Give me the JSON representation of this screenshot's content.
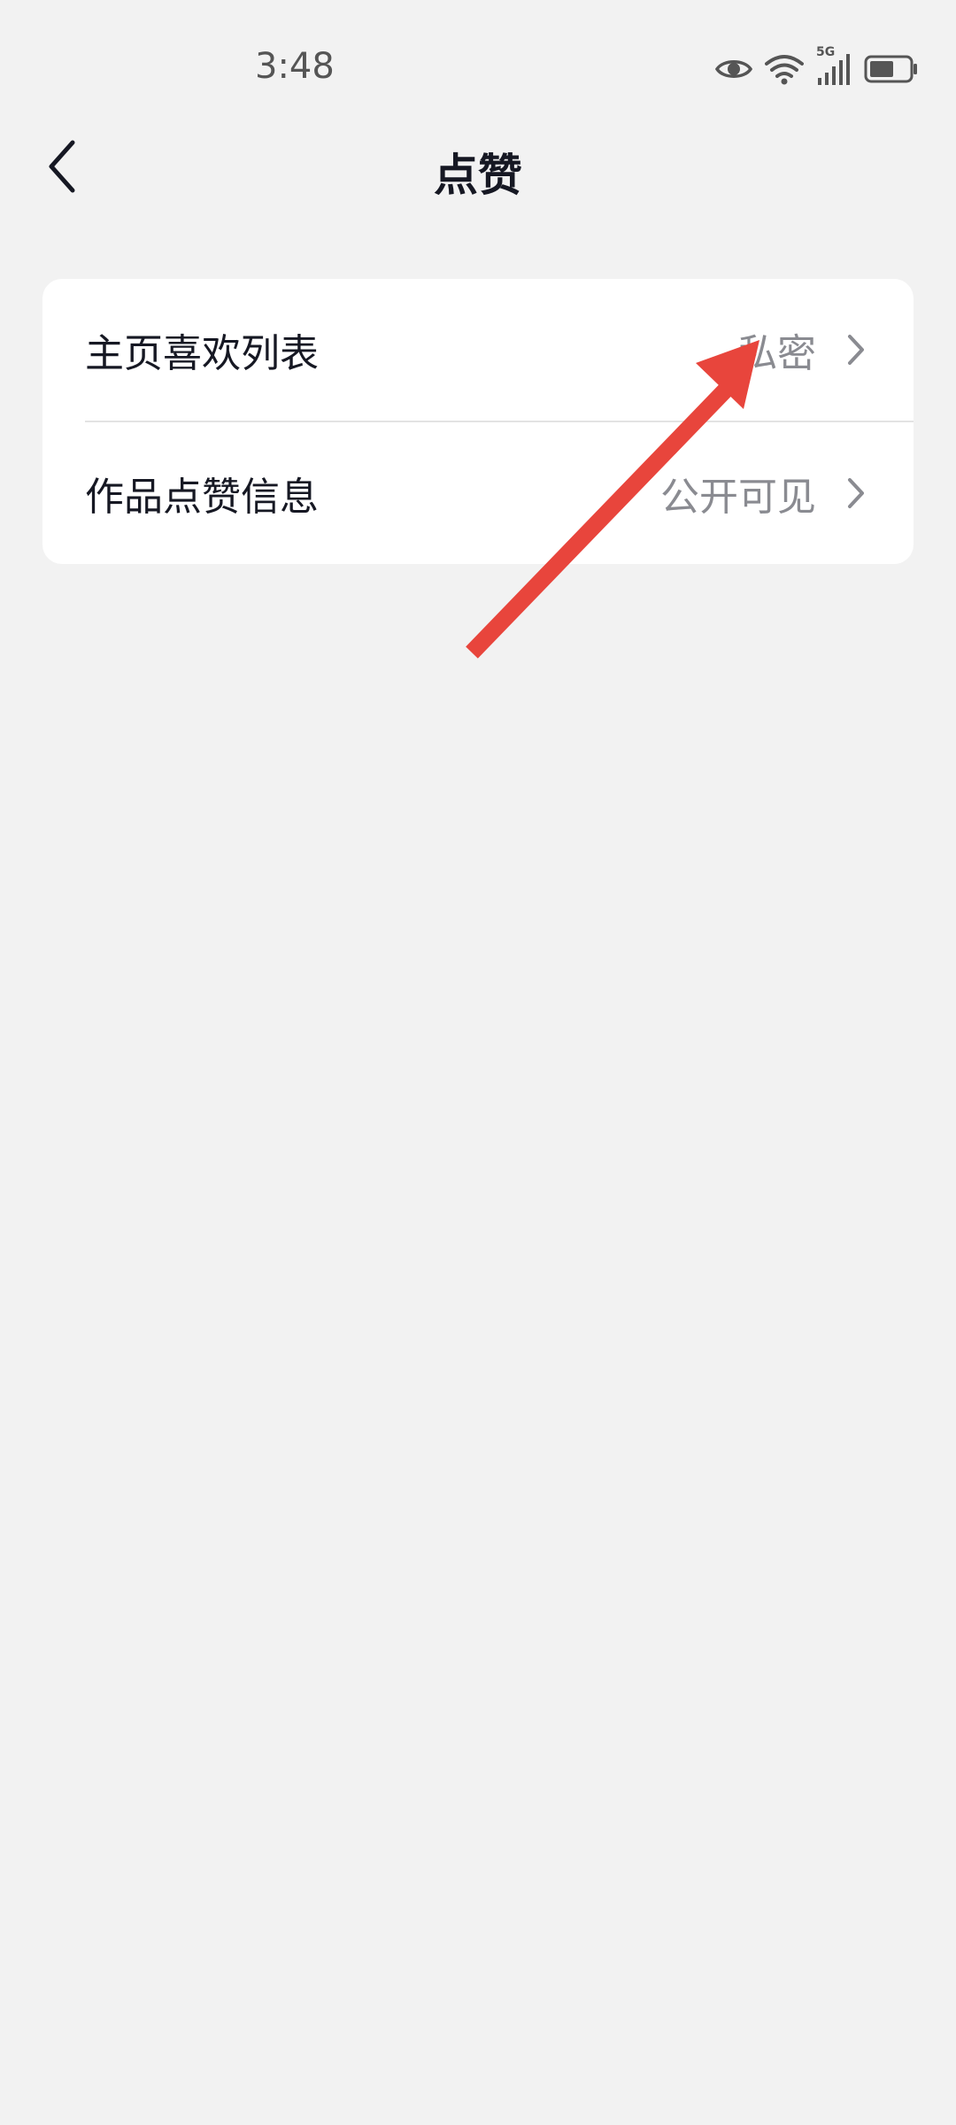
{
  "status_bar": {
    "time": "3:48",
    "network_label": "5G",
    "icons": [
      "eye-icon",
      "wifi-icon",
      "signal-icon",
      "battery-icon"
    ]
  },
  "header": {
    "title": "点赞",
    "back_icon": "chevron-left-icon"
  },
  "settings": {
    "items": [
      {
        "label": "主页喜欢列表",
        "value": "私密"
      },
      {
        "label": "作品点赞信息",
        "value": "公开可见"
      }
    ]
  },
  "annotation": {
    "type": "arrow",
    "color": "#e8453c"
  },
  "colors": {
    "background": "#f2f2f2",
    "card": "#ffffff",
    "primary_text": "#161823",
    "secondary_text": "#8a8b91",
    "annotation": "#e8453c"
  }
}
